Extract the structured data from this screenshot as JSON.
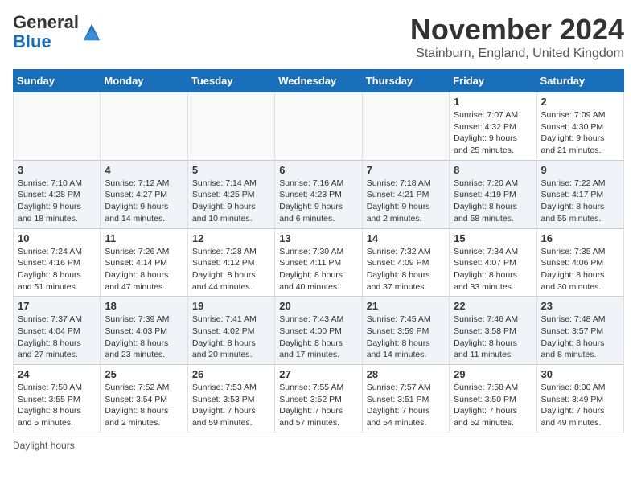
{
  "header": {
    "logo_general": "General",
    "logo_blue": "Blue",
    "month_title": "November 2024",
    "location": "Stainburn, England, United Kingdom"
  },
  "days_of_week": [
    "Sunday",
    "Monday",
    "Tuesday",
    "Wednesday",
    "Thursday",
    "Friday",
    "Saturday"
  ],
  "legend_label": "Daylight hours",
  "weeks": [
    [
      {
        "day": "",
        "sunrise": "",
        "sunset": "",
        "daylight": ""
      },
      {
        "day": "",
        "sunrise": "",
        "sunset": "",
        "daylight": ""
      },
      {
        "day": "",
        "sunrise": "",
        "sunset": "",
        "daylight": ""
      },
      {
        "day": "",
        "sunrise": "",
        "sunset": "",
        "daylight": ""
      },
      {
        "day": "",
        "sunrise": "",
        "sunset": "",
        "daylight": ""
      },
      {
        "day": "1",
        "sunrise": "Sunrise: 7:07 AM",
        "sunset": "Sunset: 4:32 PM",
        "daylight": "Daylight: 9 hours and 25 minutes."
      },
      {
        "day": "2",
        "sunrise": "Sunrise: 7:09 AM",
        "sunset": "Sunset: 4:30 PM",
        "daylight": "Daylight: 9 hours and 21 minutes."
      }
    ],
    [
      {
        "day": "3",
        "sunrise": "Sunrise: 7:10 AM",
        "sunset": "Sunset: 4:28 PM",
        "daylight": "Daylight: 9 hours and 18 minutes."
      },
      {
        "day": "4",
        "sunrise": "Sunrise: 7:12 AM",
        "sunset": "Sunset: 4:27 PM",
        "daylight": "Daylight: 9 hours and 14 minutes."
      },
      {
        "day": "5",
        "sunrise": "Sunrise: 7:14 AM",
        "sunset": "Sunset: 4:25 PM",
        "daylight": "Daylight: 9 hours and 10 minutes."
      },
      {
        "day": "6",
        "sunrise": "Sunrise: 7:16 AM",
        "sunset": "Sunset: 4:23 PM",
        "daylight": "Daylight: 9 hours and 6 minutes."
      },
      {
        "day": "7",
        "sunrise": "Sunrise: 7:18 AM",
        "sunset": "Sunset: 4:21 PM",
        "daylight": "Daylight: 9 hours and 2 minutes."
      },
      {
        "day": "8",
        "sunrise": "Sunrise: 7:20 AM",
        "sunset": "Sunset: 4:19 PM",
        "daylight": "Daylight: 8 hours and 58 minutes."
      },
      {
        "day": "9",
        "sunrise": "Sunrise: 7:22 AM",
        "sunset": "Sunset: 4:17 PM",
        "daylight": "Daylight: 8 hours and 55 minutes."
      }
    ],
    [
      {
        "day": "10",
        "sunrise": "Sunrise: 7:24 AM",
        "sunset": "Sunset: 4:16 PM",
        "daylight": "Daylight: 8 hours and 51 minutes."
      },
      {
        "day": "11",
        "sunrise": "Sunrise: 7:26 AM",
        "sunset": "Sunset: 4:14 PM",
        "daylight": "Daylight: 8 hours and 47 minutes."
      },
      {
        "day": "12",
        "sunrise": "Sunrise: 7:28 AM",
        "sunset": "Sunset: 4:12 PM",
        "daylight": "Daylight: 8 hours and 44 minutes."
      },
      {
        "day": "13",
        "sunrise": "Sunrise: 7:30 AM",
        "sunset": "Sunset: 4:11 PM",
        "daylight": "Daylight: 8 hours and 40 minutes."
      },
      {
        "day": "14",
        "sunrise": "Sunrise: 7:32 AM",
        "sunset": "Sunset: 4:09 PM",
        "daylight": "Daylight: 8 hours and 37 minutes."
      },
      {
        "day": "15",
        "sunrise": "Sunrise: 7:34 AM",
        "sunset": "Sunset: 4:07 PM",
        "daylight": "Daylight: 8 hours and 33 minutes."
      },
      {
        "day": "16",
        "sunrise": "Sunrise: 7:35 AM",
        "sunset": "Sunset: 4:06 PM",
        "daylight": "Daylight: 8 hours and 30 minutes."
      }
    ],
    [
      {
        "day": "17",
        "sunrise": "Sunrise: 7:37 AM",
        "sunset": "Sunset: 4:04 PM",
        "daylight": "Daylight: 8 hours and 27 minutes."
      },
      {
        "day": "18",
        "sunrise": "Sunrise: 7:39 AM",
        "sunset": "Sunset: 4:03 PM",
        "daylight": "Daylight: 8 hours and 23 minutes."
      },
      {
        "day": "19",
        "sunrise": "Sunrise: 7:41 AM",
        "sunset": "Sunset: 4:02 PM",
        "daylight": "Daylight: 8 hours and 20 minutes."
      },
      {
        "day": "20",
        "sunrise": "Sunrise: 7:43 AM",
        "sunset": "Sunset: 4:00 PM",
        "daylight": "Daylight: 8 hours and 17 minutes."
      },
      {
        "day": "21",
        "sunrise": "Sunrise: 7:45 AM",
        "sunset": "Sunset: 3:59 PM",
        "daylight": "Daylight: 8 hours and 14 minutes."
      },
      {
        "day": "22",
        "sunrise": "Sunrise: 7:46 AM",
        "sunset": "Sunset: 3:58 PM",
        "daylight": "Daylight: 8 hours and 11 minutes."
      },
      {
        "day": "23",
        "sunrise": "Sunrise: 7:48 AM",
        "sunset": "Sunset: 3:57 PM",
        "daylight": "Daylight: 8 hours and 8 minutes."
      }
    ],
    [
      {
        "day": "24",
        "sunrise": "Sunrise: 7:50 AM",
        "sunset": "Sunset: 3:55 PM",
        "daylight": "Daylight: 8 hours and 5 minutes."
      },
      {
        "day": "25",
        "sunrise": "Sunrise: 7:52 AM",
        "sunset": "Sunset: 3:54 PM",
        "daylight": "Daylight: 8 hours and 2 minutes."
      },
      {
        "day": "26",
        "sunrise": "Sunrise: 7:53 AM",
        "sunset": "Sunset: 3:53 PM",
        "daylight": "Daylight: 7 hours and 59 minutes."
      },
      {
        "day": "27",
        "sunrise": "Sunrise: 7:55 AM",
        "sunset": "Sunset: 3:52 PM",
        "daylight": "Daylight: 7 hours and 57 minutes."
      },
      {
        "day": "28",
        "sunrise": "Sunrise: 7:57 AM",
        "sunset": "Sunset: 3:51 PM",
        "daylight": "Daylight: 7 hours and 54 minutes."
      },
      {
        "day": "29",
        "sunrise": "Sunrise: 7:58 AM",
        "sunset": "Sunset: 3:50 PM",
        "daylight": "Daylight: 7 hours and 52 minutes."
      },
      {
        "day": "30",
        "sunrise": "Sunrise: 8:00 AM",
        "sunset": "Sunset: 3:49 PM",
        "daylight": "Daylight: 7 hours and 49 minutes."
      }
    ]
  ]
}
